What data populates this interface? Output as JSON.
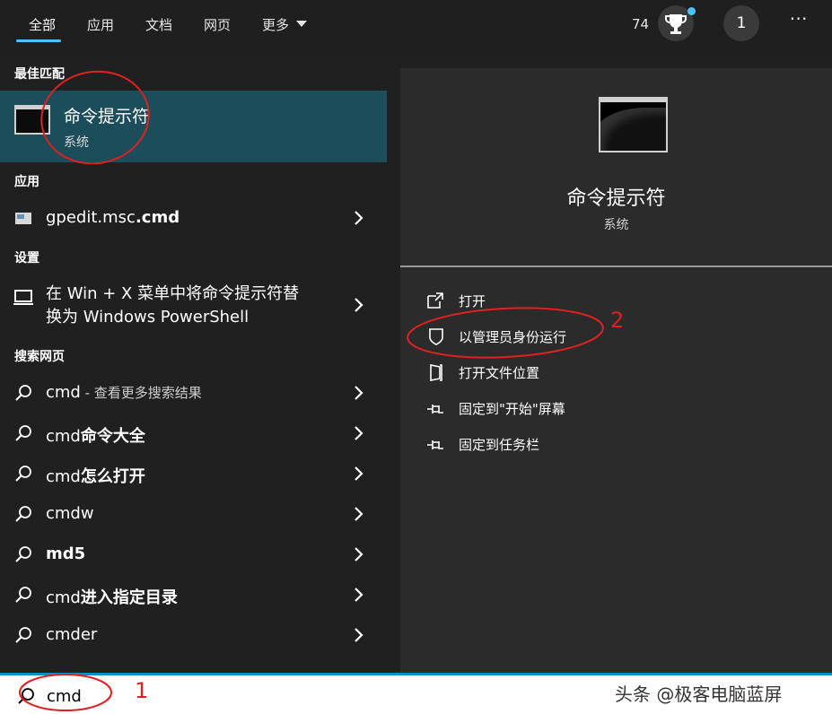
{
  "tabs": [
    "全部",
    "应用",
    "文档",
    "网页",
    "更多"
  ],
  "header": {
    "points": "74",
    "account_initial": "1",
    "options": "⋯"
  },
  "sections": {
    "best_match": "最佳匹配",
    "apps": "应用",
    "settings": "设置",
    "web": "搜索网页"
  },
  "best_match": {
    "title": "命令提示符",
    "subtitle": "系统"
  },
  "apps": [
    {
      "name": "gpedit.msc",
      "bold": ".cmd"
    }
  ],
  "settings": [
    {
      "line1": "在 Win + X 菜单中将命令提示符替",
      "line2": "换为 Windows PowerShell"
    }
  ],
  "web_results": [
    {
      "prefix": "cmd",
      "bold": "",
      "suffix": " - 查看更多搜索结果"
    },
    {
      "prefix": "cmd",
      "bold": "命令大全",
      "suffix": ""
    },
    {
      "prefix": "cmd",
      "bold": "怎么打开",
      "suffix": ""
    },
    {
      "prefix": "cmdw",
      "bold": "",
      "suffix": ""
    },
    {
      "prefix": "",
      "bold": "md5",
      "suffix": ""
    },
    {
      "prefix": "cmd",
      "bold": "进入指定目录",
      "suffix": ""
    },
    {
      "prefix": "cmder",
      "bold": "",
      "suffix": ""
    }
  ],
  "preview": {
    "title": "命令提示符",
    "subtitle": "系统",
    "actions": [
      {
        "label": "打开",
        "icon": "open-icon"
      },
      {
        "label": "以管理员身份运行",
        "icon": "shield-icon"
      },
      {
        "label": "打开文件位置",
        "icon": "folder-icon"
      },
      {
        "label": "固定到\"开始\"屏幕",
        "icon": "pin-icon"
      },
      {
        "label": "固定到任务栏",
        "icon": "pin-icon"
      }
    ]
  },
  "search": {
    "value": "cmd"
  },
  "annotations": {
    "one": "1",
    "two": "2"
  },
  "watermark": "头条 @极客电脑蓝屏",
  "colors": {
    "accent": "#4cc2ff",
    "selected_bg": "#1b4d5a",
    "annotation": "#e02020"
  }
}
